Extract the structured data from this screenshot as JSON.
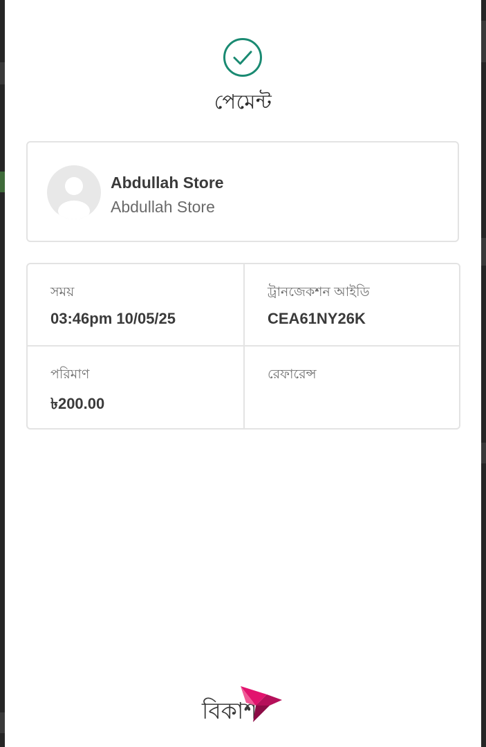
{
  "header": {
    "icon": "check-circle-icon",
    "title": "পেমেন্ট"
  },
  "merchant": {
    "avatar_icon": "user-placeholder-icon",
    "name": "Abdullah Store",
    "account": "Abdullah Store"
  },
  "details": {
    "time": {
      "label": "সময়",
      "value": "03:46pm 10/05/25"
    },
    "transaction_id": {
      "label": "ট্রানজেকশন আইডি",
      "value": "CEA61NY26K"
    },
    "amount": {
      "label": "পরিমাণ",
      "value": "৳200.00"
    },
    "reference": {
      "label": "রেফারেন্স",
      "value": ""
    }
  },
  "brand": {
    "logo_text": "বিকাশ",
    "logo_icon": "bkash-bird-icon",
    "accent_color": "#e2136e",
    "success_color": "#1a8a72"
  }
}
